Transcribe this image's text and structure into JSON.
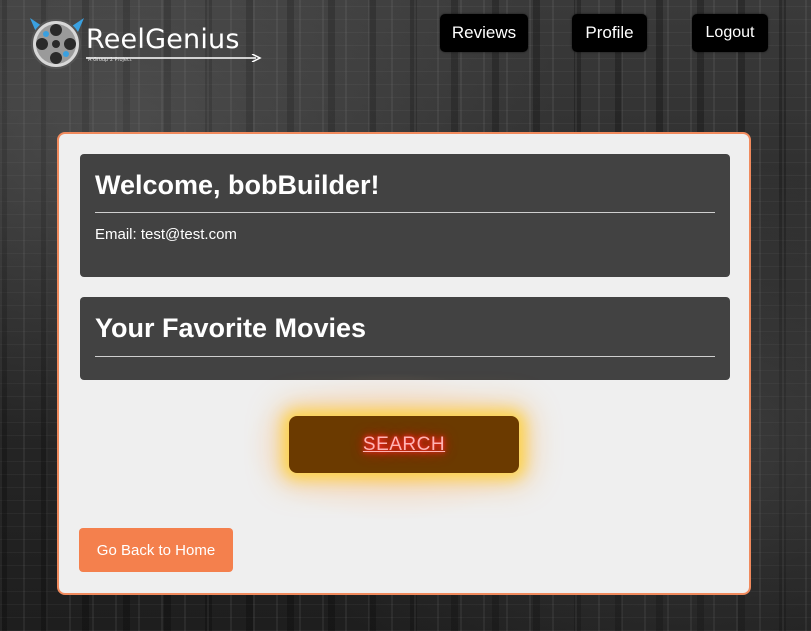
{
  "header": {
    "brand_name": "ReelGenius",
    "brand_tagline": "A Group 2 Project",
    "nav": {
      "reviews": "Reviews",
      "profile": "Profile",
      "logout": "Logout"
    }
  },
  "welcome": {
    "title": "Welcome, bobBuilder!",
    "email_line": "Email: test@test.com"
  },
  "favorites": {
    "title": "Your Favorite Movies"
  },
  "search": {
    "label": "SEARCH"
  },
  "home": {
    "label": "Go Back to Home"
  },
  "colors": {
    "accent": "#f08a5d",
    "panel": "#424242",
    "search_bg": "#6b3a00"
  }
}
